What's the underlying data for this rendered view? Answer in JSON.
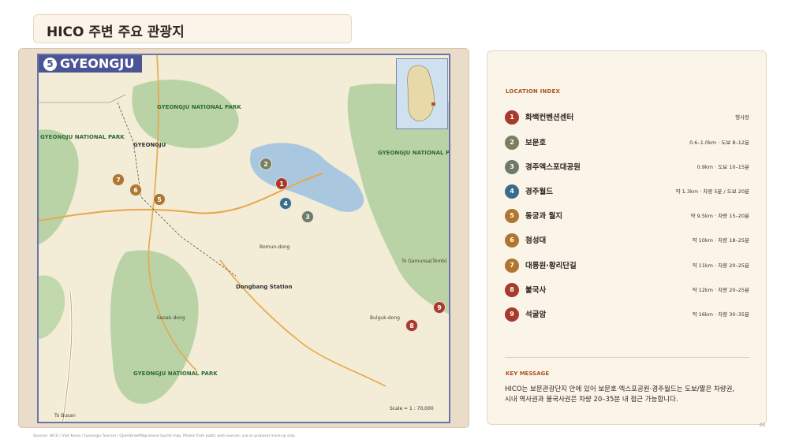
{
  "page_title": "HICO 주변 주요 관광지",
  "map": {
    "badge_number": "5",
    "badge_title": "GYEONGJU",
    "scale_label": "Scale = 1 : 70,000",
    "labels": {
      "park_north": "GYEONGJU NATIONAL PARK",
      "park_west": "GYEONGJU NATIONAL PARK",
      "park_east": "GYEONGJU NATIONAL PARK",
      "park_south": "GYEONGJU NATIONAL PARK",
      "city": "GYEONGJU",
      "bomun": "Bomun-dong",
      "bulguk": "Bulguk-dong",
      "dongbang": "Dongbang Station",
      "pond": "Seoak-dong",
      "tobuse": "To Busan",
      "toulsan": "To Gamunsa(Tomb)"
    },
    "pins": [
      {
        "num": "1",
        "color": "#a83a2c"
      },
      {
        "num": "2",
        "color": "#7a7f62"
      },
      {
        "num": "3",
        "color": "#6f7a6a"
      },
      {
        "num": "4",
        "color": "#3a6b8a"
      },
      {
        "num": "5",
        "color": "#b0752e"
      },
      {
        "num": "6",
        "color": "#b0752e"
      },
      {
        "num": "7",
        "color": "#b0752e"
      },
      {
        "num": "8",
        "color": "#a83a2c"
      },
      {
        "num": "9",
        "color": "#a83a2c"
      }
    ]
  },
  "source_note": "Sources: HICO / Visit Korea / Gyeongju Tourism / OpenStreetMap-based tourist map. Photos from public web sources; use as proposal mock-up only.",
  "index": {
    "heading": "LOCATION INDEX",
    "items": [
      {
        "num": "1",
        "name": "화백컨벤션센터",
        "dist": "행사장",
        "color": "#a83a2c"
      },
      {
        "num": "2",
        "name": "보문호",
        "dist": "0.6–1.0km · 도보 8–12분",
        "color": "#7a7f62"
      },
      {
        "num": "3",
        "name": "경주엑스포대공원",
        "dist": "0.9km · 도보 10–15분",
        "color": "#6f7a6a"
      },
      {
        "num": "4",
        "name": "경주월드",
        "dist": "약 1.3km · 차량 5분 / 도보 20분",
        "color": "#3a6b8a"
      },
      {
        "num": "5",
        "name": "동궁과 월지",
        "dist": "약 9.5km · 차량 15–20분",
        "color": "#b0752e"
      },
      {
        "num": "6",
        "name": "첨성대",
        "dist": "약 10km · 차량 18–25분",
        "color": "#b0752e"
      },
      {
        "num": "7",
        "name": "대릉원·황리단길",
        "dist": "약 11km · 차량 20–25분",
        "color": "#b0752e"
      },
      {
        "num": "8",
        "name": "불국사",
        "dist": "약 12km · 차량 20–25분",
        "color": "#a83a2c"
      },
      {
        "num": "9",
        "name": "석굴암",
        "dist": "약 16km · 차량 30–35분",
        "color": "#a83a2c"
      }
    ]
  },
  "key": {
    "heading": "KEY MESSAGE",
    "message": "HICO는 보문관광단지 안에 있어 보문호·엑스포공원·경주월드는 도보/짧은 차량권, 시내 역사권과 불국사권은 차량 20–35분 내 접근 가능합니다."
  },
  "page_number": "01"
}
